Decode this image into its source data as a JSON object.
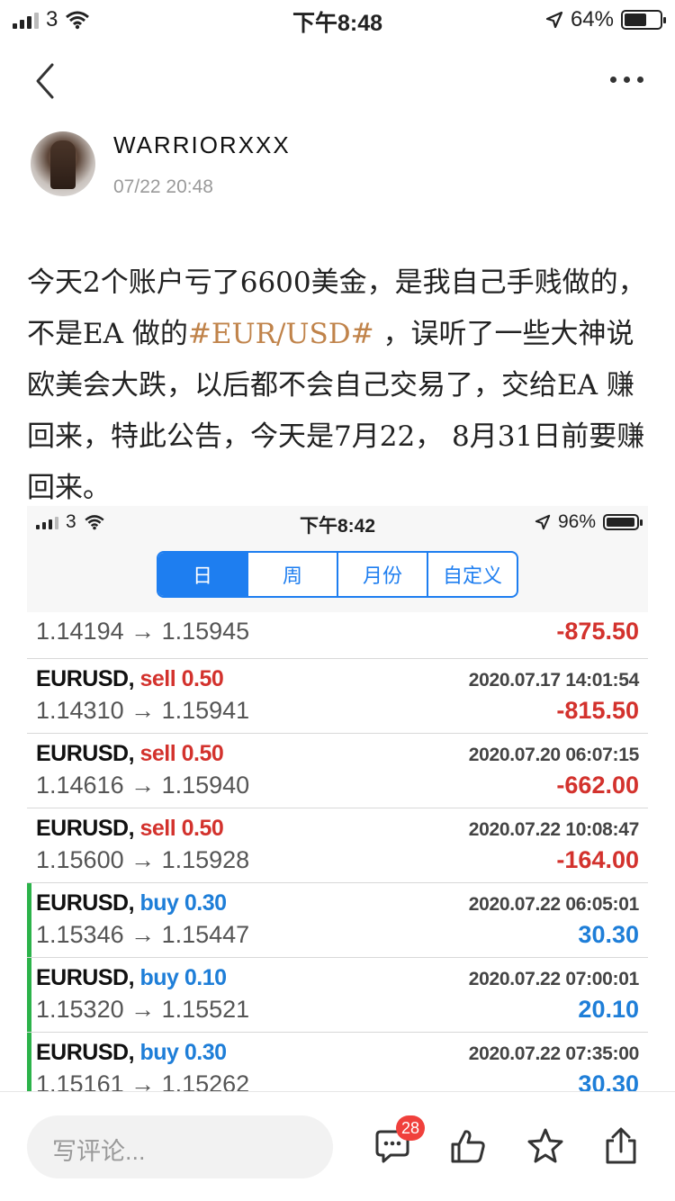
{
  "status_bar": {
    "carrier": "3",
    "time": "下午8:48",
    "battery": "64%",
    "battery_level": 0.64
  },
  "nav": {
    "back_icon": "chevron-left-icon",
    "more_icon": "more-icon"
  },
  "author": {
    "username": "WARRIORXXX",
    "time": "07/22 20:48"
  },
  "post": {
    "text_before": "今天2个账户亏了6600美金，是我自己手贱做的，不是EA 做的",
    "tag": "#EUR/USD#",
    "text_after": " ，误听了一些大神说欧美会大跌，以后都不会自己交易了，交给EA 赚回来，特此公告，今天是7月22， 8月31日前要赚回来。"
  },
  "screenshot": {
    "status_bar": {
      "carrier": "3",
      "time": "下午8:42",
      "battery": "96%",
      "battery_level": 0.96
    },
    "tabs": [
      "日",
      "周",
      "月份",
      "自定义"
    ],
    "partial_row": {
      "prices": "1.14194 → 1.15945",
      "pl": "-875.50"
    },
    "trades": [
      {
        "symbol": "EURUSD,",
        "side": "sell 0.50",
        "datetime": "2020.07.17 14:01:54",
        "prices": "1.14310 → 1.15941",
        "pl": "-815.50",
        "type": "sell"
      },
      {
        "symbol": "EURUSD,",
        "side": "sell 0.50",
        "datetime": "2020.07.20 06:07:15",
        "prices": "1.14616 → 1.15940",
        "pl": "-662.00",
        "type": "sell"
      },
      {
        "symbol": "EURUSD,",
        "side": "sell 0.50",
        "datetime": "2020.07.22 10:08:47",
        "prices": "1.15600 → 1.15928",
        "pl": "-164.00",
        "type": "sell"
      },
      {
        "symbol": "EURUSD,",
        "side": "buy 0.30",
        "datetime": "2020.07.22 06:05:01",
        "prices": "1.15346 → 1.15447",
        "pl": "30.30",
        "type": "buy"
      },
      {
        "symbol": "EURUSD,",
        "side": "buy 0.10",
        "datetime": "2020.07.22 07:00:01",
        "prices": "1.15320 → 1.15521",
        "pl": "20.10",
        "type": "buy"
      },
      {
        "symbol": "EURUSD,",
        "side": "buy 0.30",
        "datetime": "2020.07.22 07:35:00",
        "prices": "1.15161 → 1.15262",
        "pl": "30.30",
        "type": "buy"
      }
    ]
  },
  "bottom_bar": {
    "comment_placeholder": "写评论...",
    "comment_count": "28"
  }
}
